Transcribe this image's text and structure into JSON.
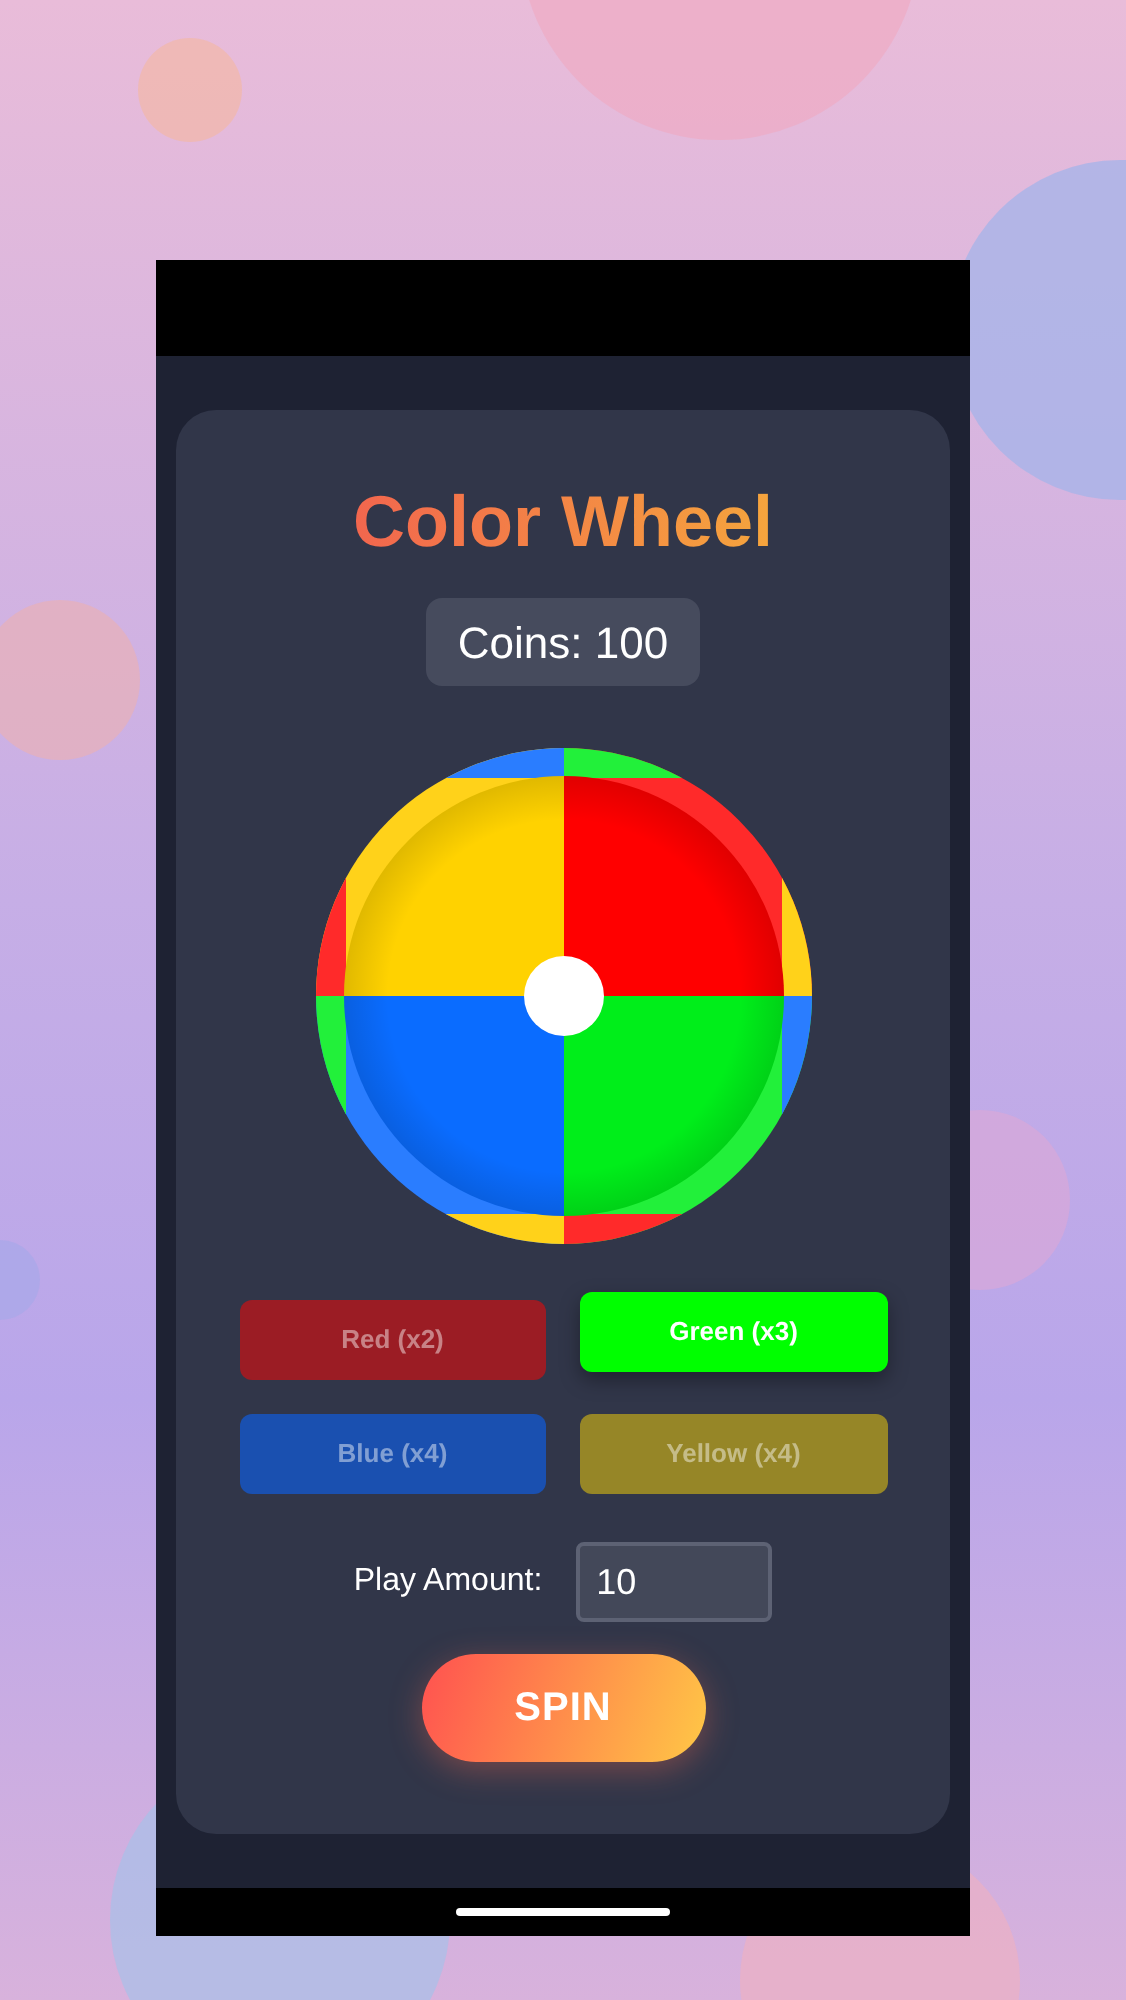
{
  "title": "Color Wheel",
  "coins": "Coins: 100",
  "bets": [
    {
      "label": "Red (x2)",
      "selected": false,
      "color": "#9b1c24"
    },
    {
      "label": "Green (x3)",
      "selected": true,
      "color": "#00ff00"
    },
    {
      "label": "Blue (x4)",
      "selected": false,
      "color": "#1a50b0"
    },
    {
      "label": "Yellow (x4)",
      "selected": false,
      "color": "#968627"
    }
  ],
  "play_amount": {
    "label": "Play Amount:",
    "value": "10"
  },
  "spin_button": "SPIN"
}
